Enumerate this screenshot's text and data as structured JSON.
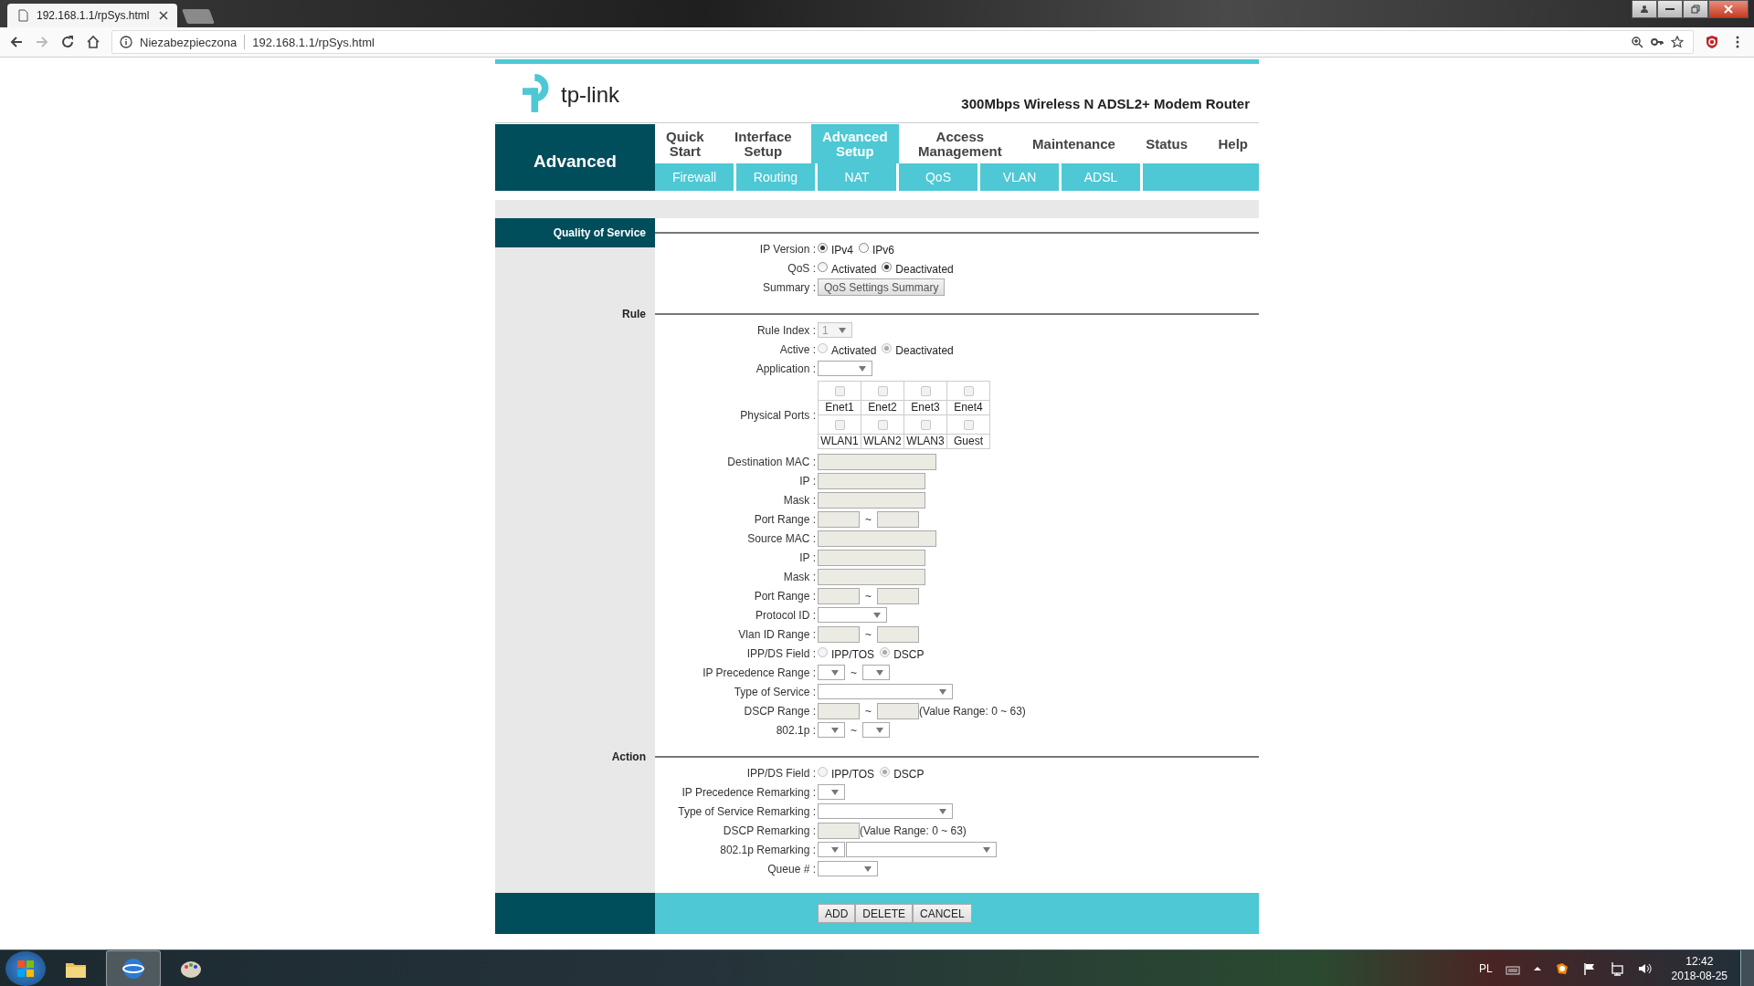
{
  "browser": {
    "tab_title": "192.168.1.1/rpSys.html",
    "security": "Niezabezpieczona",
    "url": "192.168.1.1/rpSys.html"
  },
  "header": {
    "logo": "tp-link",
    "product": "300Mbps Wireless N ADSL2+ Modem Router"
  },
  "nav": {
    "section": "Advanced",
    "menu": [
      {
        "label": "Quick Start",
        "selected": false
      },
      {
        "label": "Interface Setup",
        "selected": false
      },
      {
        "label": "Advanced Setup",
        "selected": true
      },
      {
        "label": "Access Management",
        "selected": false
      },
      {
        "label": "Maintenance",
        "selected": false
      },
      {
        "label": "Status",
        "selected": false
      },
      {
        "label": "Help",
        "selected": false
      }
    ],
    "submenu": [
      {
        "label": "Firewall"
      },
      {
        "label": "Routing"
      },
      {
        "label": "NAT"
      },
      {
        "label": "QoS"
      },
      {
        "label": "VLAN"
      },
      {
        "label": "ADSL"
      }
    ]
  },
  "sections": [
    {
      "title": "Quality of Service",
      "kind": "header",
      "rows": [
        {
          "label": "IP Version :",
          "controls": [
            {
              "kind": "radio",
              "label": "IPv4",
              "selected": true,
              "disabled": false
            },
            {
              "kind": "radio",
              "label": "IPv6",
              "selected": false,
              "disabled": false
            }
          ]
        },
        {
          "label": "QoS :",
          "controls": [
            {
              "kind": "radio",
              "label": "Activated",
              "selected": false,
              "disabled": false
            },
            {
              "kind": "radio",
              "label": "Deactivated",
              "selected": true,
              "disabled": false
            }
          ]
        },
        {
          "label": "Summary :",
          "controls": [
            {
              "kind": "button",
              "label": "QoS Settings Summary"
            }
          ]
        }
      ]
    },
    {
      "title": "Rule",
      "kind": "divider",
      "rows": [
        {
          "label": "Rule Index :",
          "controls": [
            {
              "kind": "index-select",
              "value": "1",
              "disabled": true
            }
          ]
        },
        {
          "label": "Active :",
          "controls": [
            {
              "kind": "radio",
              "label": "Activated",
              "selected": false,
              "disabled": true
            },
            {
              "kind": "radio",
              "label": "Deactivated",
              "selected": true,
              "disabled": true
            }
          ]
        },
        {
          "label": "Application :",
          "controls": [
            {
              "kind": "list-select",
              "disabled": false
            }
          ]
        },
        {
          "label": "Physical Ports :",
          "controls": [
            {
              "kind": "ports",
              "ports": [
                {
                  "label": "Enet1",
                  "checked": false,
                  "disabled": true
                },
                {
                  "label": "Enet2",
                  "checked": false,
                  "disabled": true
                },
                {
                  "label": "Enet3",
                  "checked": false,
                  "disabled": true
                },
                {
                  "label": "Enet4",
                  "checked": false,
                  "disabled": true
                },
                {
                  "label": "WLAN1",
                  "checked": false,
                  "disabled": true
                },
                {
                  "label": "WLAN2",
                  "checked": false,
                  "disabled": true
                },
                {
                  "label": "WLAN3",
                  "checked": false,
                  "disabled": true
                },
                {
                  "label": "Guest",
                  "checked": false,
                  "disabled": true
                }
              ]
            }
          ]
        },
        {
          "label": "Destination MAC :",
          "controls": [
            {
              "kind": "mac-field"
            }
          ]
        },
        {
          "label": "IP :",
          "controls": [
            {
              "kind": "ip-field"
            }
          ]
        },
        {
          "label": "Mask :",
          "controls": [
            {
              "kind": "ip-field"
            }
          ]
        },
        {
          "label": "Port Range :",
          "controls": [
            {
              "kind": "port-field"
            },
            {
              "kind": "separator",
              "text": "~"
            },
            {
              "kind": "port-field"
            }
          ]
        },
        {
          "label": "Source MAC :",
          "controls": [
            {
              "kind": "mac-field"
            }
          ]
        },
        {
          "label": "IP :",
          "controls": [
            {
              "kind": "ip-field"
            }
          ]
        },
        {
          "label": "Mask :",
          "controls": [
            {
              "kind": "ip-field"
            }
          ]
        },
        {
          "label": "Port Range :",
          "controls": [
            {
              "kind": "port-field"
            },
            {
              "kind": "separator",
              "text": "~"
            },
            {
              "kind": "port-field"
            }
          ]
        },
        {
          "label": "Protocol ID :",
          "controls": [
            {
              "kind": "protocol-select",
              "disabled": false
            }
          ]
        },
        {
          "label": "Vlan ID Range :",
          "controls": [
            {
              "kind": "port-field"
            },
            {
              "kind": "separator",
              "text": "~"
            },
            {
              "kind": "port-field"
            }
          ]
        },
        {
          "label": "IPP/DS Field :",
          "controls": [
            {
              "kind": "radio",
              "label": "IPP/TOS",
              "selected": false,
              "disabled": true
            },
            {
              "kind": "radio",
              "label": "DSCP",
              "selected": true,
              "disabled": true
            }
          ]
        },
        {
          "label": "IP Precedence Range :",
          "controls": [
            {
              "kind": "level-select",
              "disabled": false
            },
            {
              "kind": "separator",
              "text": "~"
            },
            {
              "kind": "level-select",
              "disabled": false
            }
          ]
        },
        {
          "label": "Type of Service :",
          "controls": [
            {
              "kind": "service-select",
              "disabled": false
            }
          ]
        },
        {
          "label": "DSCP Range :",
          "controls": [
            {
              "kind": "port-field"
            },
            {
              "kind": "separator",
              "text": "~"
            },
            {
              "kind": "port-field"
            },
            {
              "kind": "note",
              "text": "(Value Range: 0 ~ 63)"
            }
          ]
        },
        {
          "label": "802.1p :",
          "controls": [
            {
              "kind": "level-select",
              "disabled": false
            },
            {
              "kind": "separator",
              "text": "~"
            },
            {
              "kind": "level-select",
              "disabled": false
            }
          ]
        }
      ]
    },
    {
      "title": "Action",
      "kind": "divider",
      "rows": [
        {
          "label": "IPP/DS Field :",
          "controls": [
            {
              "kind": "radio",
              "label": "IPP/TOS",
              "selected": false,
              "disabled": true
            },
            {
              "kind": "radio",
              "label": "DSCP",
              "selected": true,
              "disabled": true
            }
          ]
        },
        {
          "label": "IP Precedence Remarking :",
          "controls": [
            {
              "kind": "level-select",
              "disabled": false
            }
          ]
        },
        {
          "label": "Type of Service Remarking :",
          "controls": [
            {
              "kind": "service-select",
              "disabled": false
            }
          ]
        },
        {
          "label": "DSCP Remarking :",
          "controls": [
            {
              "kind": "port-field"
            },
            {
              "kind": "note",
              "text": "(Value Range: 0 ~ 63)"
            }
          ]
        },
        {
          "label": "802.1p Remarking :",
          "controls": [
            {
              "kind": "level-select",
              "disabled": false
            },
            {
              "kind": "priority-select",
              "disabled": false
            }
          ]
        },
        {
          "label": "Queue # :",
          "controls": [
            {
              "kind": "queue-select",
              "disabled": false
            }
          ]
        }
      ]
    }
  ],
  "buttons": [
    {
      "label": "ADD"
    },
    {
      "label": "DELETE"
    },
    {
      "label": "CANCEL"
    }
  ],
  "taskbar": {
    "language": "PL",
    "time": "12:42",
    "date": "2018-08-25"
  }
}
